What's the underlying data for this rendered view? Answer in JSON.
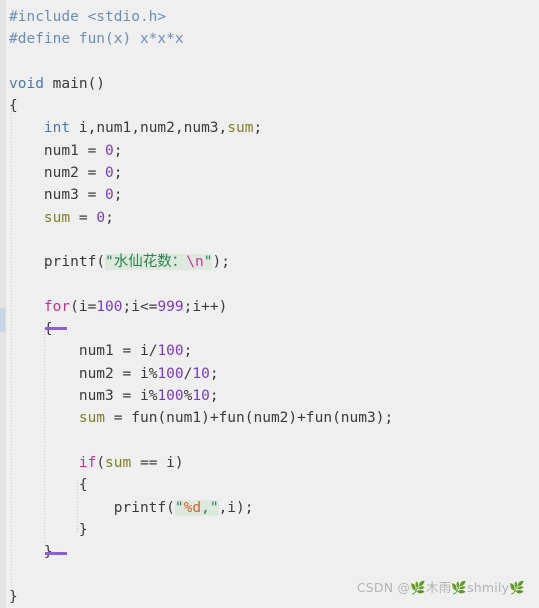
{
  "editor": {
    "background_color": "#efefef",
    "gutter_color": "#e4e4e4",
    "gutter_marker_color": "#c6d6ea",
    "bracket_match_color": "#8b5fd6",
    "string_highlight_color": "#dde9dd",
    "language": "c"
  },
  "code": {
    "lines": [
      {
        "n": 1,
        "indent": 0,
        "tokens": [
          {
            "t": "#include <stdio.h>",
            "c": "pre"
          }
        ]
      },
      {
        "n": 2,
        "indent": 0,
        "tokens": [
          {
            "t": "#define fun(x) x*x*x",
            "c": "pre"
          }
        ]
      },
      {
        "n": 3,
        "indent": 0,
        "tokens": []
      },
      {
        "n": 4,
        "indent": 0,
        "tokens": [
          {
            "t": "void",
            "c": "typ"
          },
          {
            "t": " ",
            "c": "op"
          },
          {
            "t": "main",
            "c": "fn"
          },
          {
            "t": "()",
            "c": "punct"
          }
        ]
      },
      {
        "n": 5,
        "indent": 0,
        "tokens": [
          {
            "t": "{",
            "c": "brace"
          }
        ]
      },
      {
        "n": 6,
        "indent": 1,
        "tokens": [
          {
            "t": "int",
            "c": "typ"
          },
          {
            "t": " i,num1,num2,num3,",
            "c": "id"
          },
          {
            "t": "sum",
            "c": "fld"
          },
          {
            "t": ";",
            "c": "punct"
          }
        ]
      },
      {
        "n": 7,
        "indent": 1,
        "tokens": [
          {
            "t": "num1",
            "c": "id"
          },
          {
            "t": " = ",
            "c": "op"
          },
          {
            "t": "0",
            "c": "num"
          },
          {
            "t": ";",
            "c": "punct"
          }
        ]
      },
      {
        "n": 8,
        "indent": 1,
        "tokens": [
          {
            "t": "num2",
            "c": "id"
          },
          {
            "t": " = ",
            "c": "op"
          },
          {
            "t": "0",
            "c": "num"
          },
          {
            "t": ";",
            "c": "punct"
          }
        ]
      },
      {
        "n": 9,
        "indent": 1,
        "tokens": [
          {
            "t": "num3",
            "c": "id"
          },
          {
            "t": " = ",
            "c": "op"
          },
          {
            "t": "0",
            "c": "num"
          },
          {
            "t": ";",
            "c": "punct"
          }
        ]
      },
      {
        "n": 10,
        "indent": 1,
        "tokens": [
          {
            "t": "sum",
            "c": "fld"
          },
          {
            "t": " = ",
            "c": "op"
          },
          {
            "t": "0",
            "c": "num"
          },
          {
            "t": ";",
            "c": "punct"
          }
        ]
      },
      {
        "n": 11,
        "indent": 0,
        "tokens": []
      },
      {
        "n": 12,
        "indent": 1,
        "tokens": [
          {
            "t": "printf",
            "c": "fn"
          },
          {
            "t": "(",
            "c": "punct"
          },
          {
            "t": "\"水仙花数：",
            "c": "str"
          },
          {
            "t": "\\n",
            "c": "esc"
          },
          {
            "t": "\"",
            "c": "str"
          },
          {
            "t": ");",
            "c": "punct"
          }
        ]
      },
      {
        "n": 13,
        "indent": 0,
        "tokens": []
      },
      {
        "n": 14,
        "indent": 1,
        "tokens": [
          {
            "t": "for",
            "c": "kw"
          },
          {
            "t": "(i=",
            "c": "punct"
          },
          {
            "t": "100",
            "c": "num"
          },
          {
            "t": ";i<=",
            "c": "punct"
          },
          {
            "t": "999",
            "c": "num"
          },
          {
            "t": ";i++)",
            "c": "punct"
          }
        ]
      },
      {
        "n": 15,
        "indent": 1,
        "tokens": [
          {
            "t": "{",
            "c": "brace"
          }
        ]
      },
      {
        "n": 16,
        "indent": 2,
        "tokens": [
          {
            "t": "num1",
            "c": "id"
          },
          {
            "t": " = ",
            "c": "op"
          },
          {
            "t": "i/",
            "c": "punct"
          },
          {
            "t": "100",
            "c": "num"
          },
          {
            "t": ";",
            "c": "punct"
          }
        ]
      },
      {
        "n": 17,
        "indent": 2,
        "tokens": [
          {
            "t": "num2",
            "c": "id"
          },
          {
            "t": " = ",
            "c": "op"
          },
          {
            "t": "i%",
            "c": "punct"
          },
          {
            "t": "100",
            "c": "num"
          },
          {
            "t": "/",
            "c": "punct"
          },
          {
            "t": "10",
            "c": "num"
          },
          {
            "t": ";",
            "c": "punct"
          }
        ]
      },
      {
        "n": 18,
        "indent": 2,
        "tokens": [
          {
            "t": "num3",
            "c": "id"
          },
          {
            "t": " = ",
            "c": "op"
          },
          {
            "t": "i%",
            "c": "punct"
          },
          {
            "t": "100",
            "c": "num"
          },
          {
            "t": "%",
            "c": "punct"
          },
          {
            "t": "10",
            "c": "num"
          },
          {
            "t": ";",
            "c": "punct"
          }
        ]
      },
      {
        "n": 19,
        "indent": 2,
        "tokens": [
          {
            "t": "sum",
            "c": "fld"
          },
          {
            "t": " = ",
            "c": "op"
          },
          {
            "t": "fun",
            "c": "fn"
          },
          {
            "t": "(num1)+",
            "c": "punct"
          },
          {
            "t": "fun",
            "c": "fn"
          },
          {
            "t": "(num2)+",
            "c": "punct"
          },
          {
            "t": "fun",
            "c": "fn"
          },
          {
            "t": "(num3);",
            "c": "punct"
          }
        ]
      },
      {
        "n": 20,
        "indent": 0,
        "tokens": []
      },
      {
        "n": 21,
        "indent": 2,
        "tokens": [
          {
            "t": "if",
            "c": "kw"
          },
          {
            "t": "(",
            "c": "punct"
          },
          {
            "t": "sum",
            "c": "fld"
          },
          {
            "t": " == ",
            "c": "op"
          },
          {
            "t": "i)",
            "c": "punct"
          }
        ]
      },
      {
        "n": 22,
        "indent": 2,
        "tokens": [
          {
            "t": "{",
            "c": "brace"
          }
        ]
      },
      {
        "n": 23,
        "indent": 3,
        "tokens": [
          {
            "t": "printf",
            "c": "fn"
          },
          {
            "t": "(",
            "c": "punct"
          },
          {
            "t": "\"",
            "c": "str"
          },
          {
            "t": "%d",
            "c": "fmt"
          },
          {
            "t": ",\"",
            "c": "str"
          },
          {
            "t": ",i);",
            "c": "punct"
          }
        ]
      },
      {
        "n": 24,
        "indent": 2,
        "tokens": [
          {
            "t": "}",
            "c": "brace"
          }
        ]
      },
      {
        "n": 25,
        "indent": 1,
        "tokens": [
          {
            "t": "}",
            "c": "brace"
          }
        ]
      },
      {
        "n": 26,
        "indent": 0,
        "tokens": []
      },
      {
        "n": 27,
        "indent": 0,
        "tokens": [
          {
            "t": "}",
            "c": "brace"
          }
        ]
      }
    ]
  },
  "watermark": {
    "text": "CSDN @🌿木雨🌿shmily🌿"
  }
}
